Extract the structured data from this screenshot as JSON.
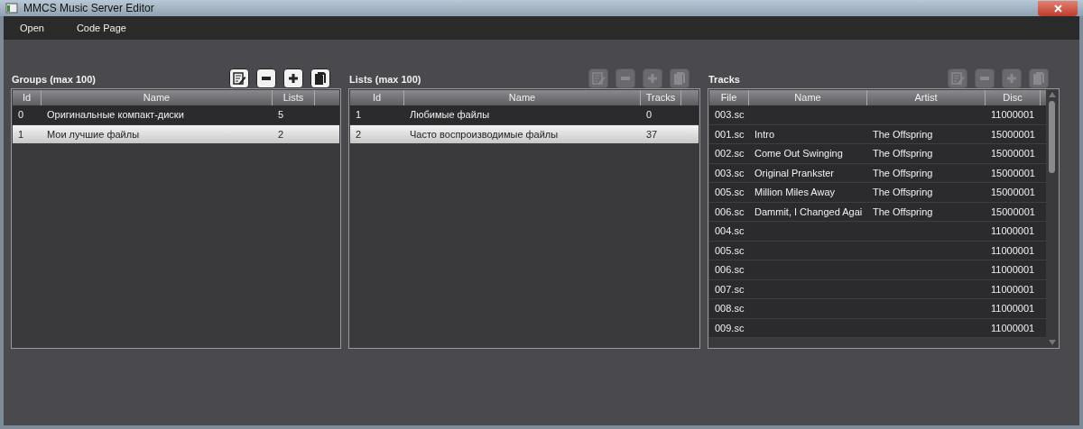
{
  "window": {
    "title": "MMCS Music Server Editor"
  },
  "menu": [
    "Open",
    "Code Page"
  ],
  "panels": [
    {
      "title": "Groups (max 100)",
      "toolbar_disabled": false,
      "columns": [
        "Id",
        "Name",
        "Lists"
      ],
      "scroll": false,
      "rows": [
        {
          "cells": [
            "0",
            "Оригинальные компакт-диски",
            "5"
          ],
          "selected": false
        },
        {
          "cells": [
            "1",
            "Мои лучшие файлы",
            "2"
          ],
          "selected": true
        }
      ]
    },
    {
      "title": "Lists (max 100)",
      "toolbar_disabled": true,
      "columns": [
        "Id",
        "Name",
        "Tracks"
      ],
      "scroll": false,
      "rows": [
        {
          "cells": [
            "1",
            "Любимые файлы",
            "0"
          ],
          "selected": false
        },
        {
          "cells": [
            "2",
            "Часто воспроизводимые файлы",
            "37"
          ],
          "selected": true
        }
      ]
    },
    {
      "title": "Tracks",
      "toolbar_disabled": true,
      "columns": [
        "File",
        "Name",
        "Artist",
        "Disc"
      ],
      "scroll": true,
      "rows": [
        {
          "cells": [
            "003.sc",
            "",
            "",
            "11000001"
          ],
          "selected": false
        },
        {
          "cells": [
            "001.sc",
            "Intro",
            "The Offspring",
            "15000001"
          ],
          "selected": false
        },
        {
          "cells": [
            "002.sc",
            "Come Out Swinging",
            "The Offspring",
            "15000001"
          ],
          "selected": false
        },
        {
          "cells": [
            "003.sc",
            "Original Prankster",
            "The Offspring",
            "15000001"
          ],
          "selected": false
        },
        {
          "cells": [
            "005.sc",
            "Million Miles Away",
            "The Offspring",
            "15000001"
          ],
          "selected": false
        },
        {
          "cells": [
            "006.sc",
            "Dammit, I Changed Agai",
            "The Offspring",
            "15000001"
          ],
          "selected": false
        },
        {
          "cells": [
            "004.sc",
            "",
            "",
            "11000001"
          ],
          "selected": false
        },
        {
          "cells": [
            "005.sc",
            "",
            "",
            "11000001"
          ],
          "selected": false
        },
        {
          "cells": [
            "006.sc",
            "",
            "",
            "11000001"
          ],
          "selected": false
        },
        {
          "cells": [
            "007.sc",
            "",
            "",
            "11000001"
          ],
          "selected": false
        },
        {
          "cells": [
            "008.sc",
            "",
            "",
            "11000001"
          ],
          "selected": false
        },
        {
          "cells": [
            "009.sc",
            "",
            "",
            "11000001"
          ],
          "selected": false
        }
      ]
    }
  ]
}
